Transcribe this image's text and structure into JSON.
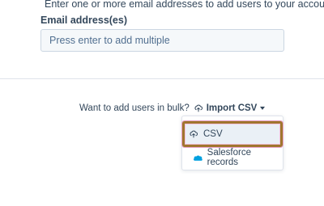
{
  "intro": {
    "text": "Enter one or more email addresses to add users to your account."
  },
  "email_field": {
    "label": "Email address(es)",
    "placeholder": "Press enter to add multiple",
    "value": ""
  },
  "bulk": {
    "prompt": "Want to add users in bulk?",
    "import_label": "Import CSV",
    "import_icon": "upload-icon",
    "caret_icon": "caret-down-icon"
  },
  "dropdown": {
    "items": [
      {
        "label": "CSV",
        "icon": "upload-icon"
      },
      {
        "label": "Salesforce records",
        "icon": "salesforce-cloud-icon"
      }
    ]
  },
  "colors": {
    "text": "#33475b",
    "input_background": "#f5f8fa",
    "input_border": "#cbd6e2",
    "highlight_border": "#a0762e",
    "highlight_glow": "#e8a3c9",
    "salesforce_blue": "#00a1e0"
  }
}
